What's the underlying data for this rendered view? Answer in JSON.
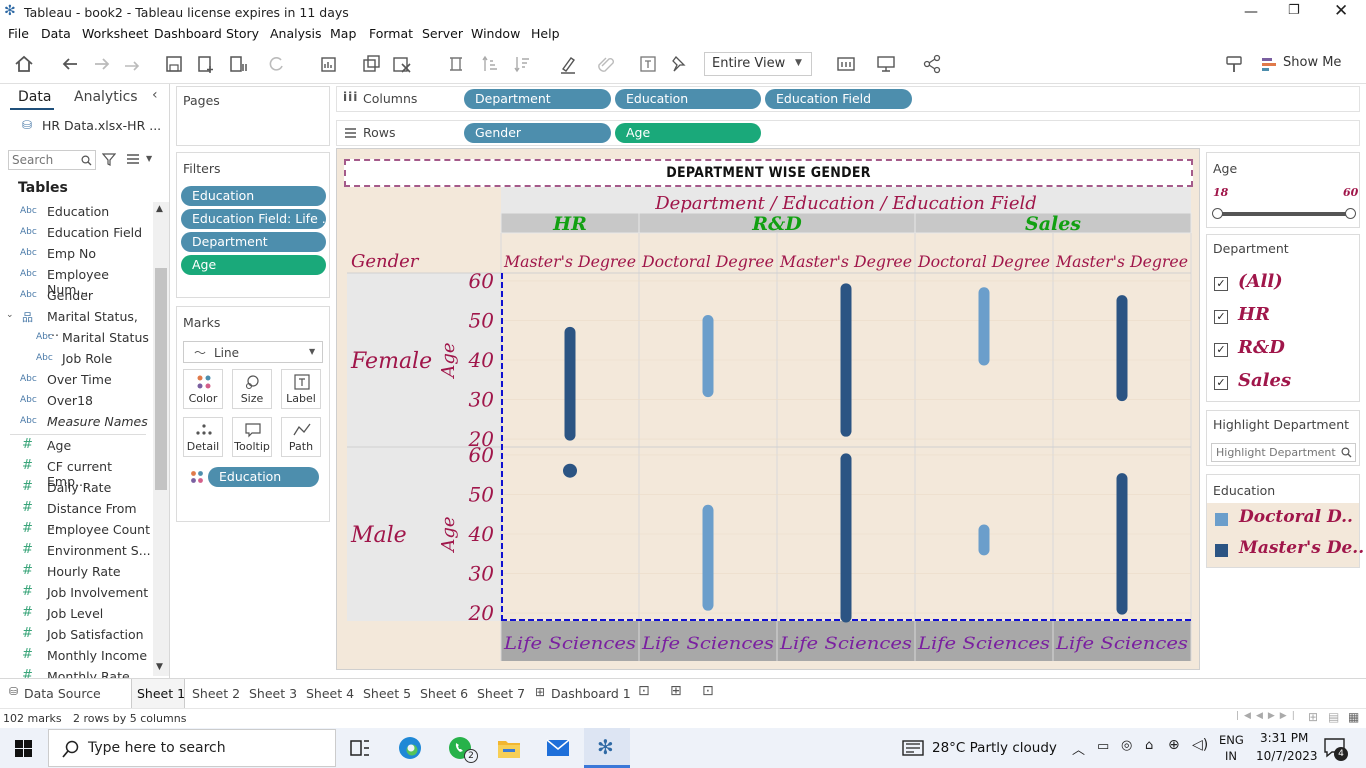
{
  "window": {
    "title": "Tableau - book2 - Tableau license expires in 11 days"
  },
  "menu": [
    "File",
    "Data",
    "Worksheet",
    "Dashboard",
    "Story",
    "Analysis",
    "Map",
    "Format",
    "Server",
    "Window",
    "Help"
  ],
  "toolbar": {
    "view_select": "Entire View",
    "show_me": "Show Me"
  },
  "left_pane": {
    "tab_data": "Data",
    "tab_analytics": "Analytics",
    "datasource": "HR Data.xlsx-HR ...",
    "search_placeholder": "Search",
    "tables_heading": "Tables",
    "dimensions": [
      {
        "type": "Abc",
        "name": "Education"
      },
      {
        "type": "Abc",
        "name": "Education Field"
      },
      {
        "type": "Abc",
        "name": "Emp No"
      },
      {
        "type": "Abc",
        "name": "Employee Num..."
      },
      {
        "type": "Abc",
        "name": "Gender"
      },
      {
        "type": "hier",
        "name": "Marital Status, ..."
      },
      {
        "type": "Abc",
        "name": "Marital Status"
      },
      {
        "type": "Abc",
        "name": "Job Role"
      },
      {
        "type": "Abc",
        "name": "Over Time"
      },
      {
        "type": "Abc",
        "name": "Over18"
      },
      {
        "type": "Abc",
        "name": "Measure Names"
      }
    ],
    "measures": [
      "Age",
      "CF current Emp...",
      "Daily Rate",
      "Distance From ...",
      "Employee Count",
      "Environment S...",
      "Hourly Rate",
      "Job Involvement",
      "Job Level",
      "Job Satisfaction",
      "Monthly Income",
      "Monthly Rate"
    ]
  },
  "pages": {
    "title": "Pages"
  },
  "filters": {
    "title": "Filters",
    "items": [
      "Education",
      "Education Field: Life ..",
      "Department",
      "Age"
    ]
  },
  "marks": {
    "title": "Marks",
    "type": "Line",
    "buttons": [
      "Color",
      "Size",
      "Label",
      "Detail",
      "Tooltip",
      "Path"
    ],
    "color_pill": "Education"
  },
  "shelves": {
    "columns_label": "Columns",
    "columns": [
      "Department",
      "Education",
      "Education Field"
    ],
    "rows_label": "Rows",
    "rows": [
      "Gender",
      "Age"
    ]
  },
  "chart_data": {
    "type": "bar",
    "title": "DEPARTMENT WISE GENDER",
    "header_title": "Department / Education / Education Field",
    "row_header_title": "Gender",
    "departments": [
      {
        "name": "HR",
        "degrees": [
          "Master's Degree"
        ]
      },
      {
        "name": "R&D",
        "degrees": [
          "Doctoral Degree",
          "Master's Degree"
        ]
      },
      {
        "name": "Sales",
        "degrees": [
          "Doctoral Degree",
          "Master's Degree"
        ]
      }
    ],
    "education_field": "Life Sciences",
    "rows": [
      "Female",
      "Male"
    ],
    "ylabel": "Age",
    "ylim": [
      18,
      62
    ],
    "yticks": [
      20,
      30,
      40,
      50,
      60
    ],
    "columns": [
      {
        "department": "HR",
        "education": "Master's Degree",
        "education_field": "Life Sciences"
      },
      {
        "department": "R&D",
        "education": "Doctoral Degree",
        "education_field": "Life Sciences"
      },
      {
        "department": "R&D",
        "education": "Master's Degree",
        "education_field": "Life Sciences"
      },
      {
        "department": "Sales",
        "education": "Doctoral Degree",
        "education_field": "Life Sciences"
      },
      {
        "department": "Sales",
        "education": "Master's Degree",
        "education_field": "Life Sciences"
      }
    ],
    "series": [
      {
        "gender": "Female",
        "ranges": [
          {
            "col": 0,
            "min": 21,
            "max": 47,
            "education": "Master's Degree"
          },
          {
            "col": 1,
            "min": 32,
            "max": 50,
            "education": "Doctoral Degree"
          },
          {
            "col": 2,
            "min": 22,
            "max": 58,
            "education": "Master's Degree"
          },
          {
            "col": 3,
            "min": 40,
            "max": 57,
            "education": "Doctoral Degree"
          },
          {
            "col": 4,
            "min": 31,
            "max": 55,
            "education": "Master's Degree"
          }
        ]
      },
      {
        "gender": "Male",
        "ranges": [
          {
            "col": 0,
            "min": 56,
            "max": 56,
            "education": "Master's Degree"
          },
          {
            "col": 1,
            "min": 22,
            "max": 46,
            "education": "Doctoral Degree"
          },
          {
            "col": 2,
            "min": 19,
            "max": 59,
            "education": "Master's Degree"
          },
          {
            "col": 3,
            "min": 36,
            "max": 41,
            "education": "Doctoral Degree"
          },
          {
            "col": 4,
            "min": 21,
            "max": 54,
            "education": "Master's Degree"
          }
        ]
      }
    ],
    "colors": {
      "Doctoral Degree": "#6b9ecb",
      "Master's Degree": "#2b5483"
    }
  },
  "right_pane": {
    "age_title": "Age",
    "age_min": "18",
    "age_max": "60",
    "dept_title": "Department",
    "dept_items": [
      "(All)",
      "HR",
      "R&D",
      "Sales"
    ],
    "highlight_title": "Highlight Department",
    "highlight_placeholder": "Highlight Department",
    "edu_title": "Education",
    "edu_items": [
      {
        "label": "Doctoral D..",
        "color": "#6b9ecb"
      },
      {
        "label": "Master's De..",
        "color": "#2b5483"
      }
    ]
  },
  "sheet_tabs": {
    "datasource": "Data Source",
    "sheets": [
      "Sheet 1",
      "Sheet 2",
      "Sheet 3",
      "Sheet 4",
      "Sheet 5",
      "Sheet 6",
      "Sheet 7"
    ],
    "dashboard": "Dashboard 1"
  },
  "status": {
    "marks": "102 marks",
    "dims": "2 rows by 5 columns"
  },
  "taskbar": {
    "search": "Type here to search",
    "weather": "28°C  Partly cloudy",
    "lang": "ENG",
    "region": "IN",
    "time": "3:31 PM",
    "date": "10/7/2023",
    "notifications": "4",
    "whatsapp_badge": "2"
  }
}
